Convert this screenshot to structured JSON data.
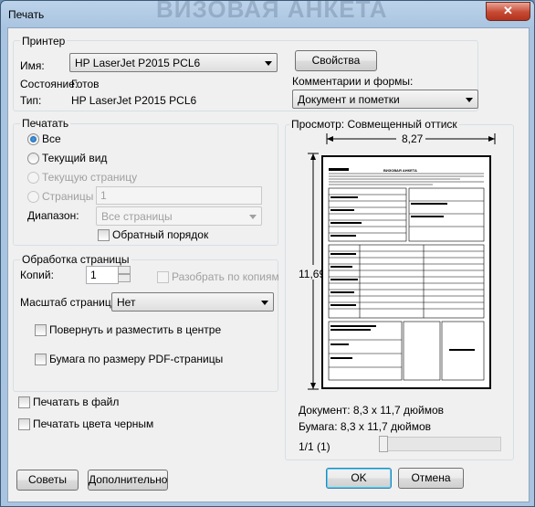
{
  "window": {
    "title": "Печать",
    "background_title": "ВИЗОВАЯ АНКЕТА",
    "close": "✕"
  },
  "printer": {
    "group_label": "Принтер",
    "name_label": "Имя:",
    "name_value": "HP LaserJet P2015 PCL6",
    "properties_button": "Свойства",
    "status_label": "Состояние:",
    "status_value": "Готов",
    "type_label": "Тип:",
    "type_value": "HP LaserJet P2015 PCL6",
    "comments_label": "Комментарии и формы:",
    "comments_value": "Документ и пометки"
  },
  "print_range": {
    "group_label": "Печатать",
    "all": "Все",
    "current_view": "Текущий вид",
    "current_page": "Текущую страницу",
    "pages": "Страницы",
    "pages_value": "1",
    "range_label": "Диапазон:",
    "range_value": "Все страницы",
    "reverse_order": "Обратный порядок"
  },
  "handling": {
    "group_label": "Обработка страницы",
    "copies_label": "Копий:",
    "copies_value": "1",
    "collate": "Разобрать по копиям",
    "scale_label": "Масштаб страницы:",
    "scale_value": "Нет",
    "rotate_center": "Повернуть и разместить в центре",
    "pdf_page_size": "Бумага по размеру PDF-страницы"
  },
  "options": {
    "print_to_file": "Печатать в файл",
    "print_black": "Печатать цвета черным"
  },
  "preview": {
    "label": "Просмотр: Совмещенный оттиск",
    "width": "8,27",
    "height": "11,69",
    "document_size": "Документ: 8,3 x 11,7 дюймов",
    "paper_size": "Бумага: 8,3 x 11,7 дюймов",
    "page_counter": "1/1 (1)",
    "page_heading": "ВИЗОВАЯ АНКЕТА"
  },
  "buttons": {
    "tips": "Советы",
    "advanced": "Дополнительно",
    "ok": "OK",
    "cancel": "Отмена"
  },
  "colors": {
    "accent": "#3c7fb1",
    "window_frame": "#a9c4e0",
    "close": "#c64a34"
  }
}
